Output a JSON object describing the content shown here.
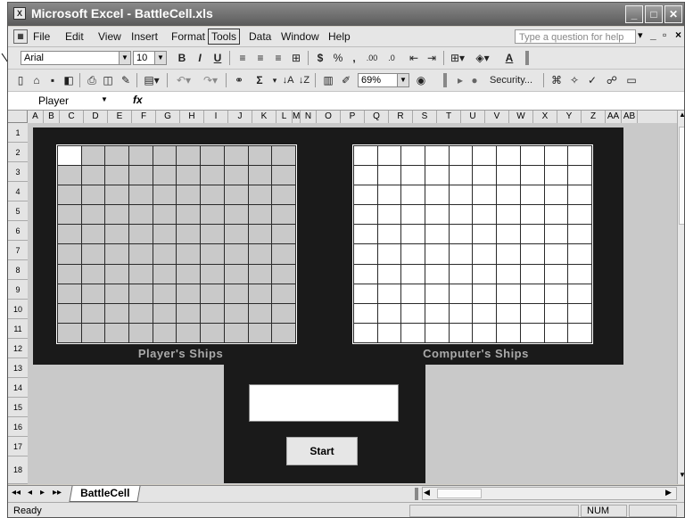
{
  "window": {
    "title": "Microsoft Excel - BattleCell.xls",
    "app_icon": "excel-icon"
  },
  "window_controls": {
    "minimize": "_",
    "maximize": "□",
    "close": "✕"
  },
  "menu": [
    "File",
    "Edit",
    "View",
    "Insert",
    "Format",
    "Tools",
    "Data",
    "Window",
    "Help"
  ],
  "help": {
    "placeholder": "Type a question for help",
    "arrow": "▾",
    "min": "_",
    "restore": "▫",
    "close": "×"
  },
  "formatting": {
    "font": "Arial",
    "size": "10",
    "bold": "B",
    "italic": "I",
    "underline": "U",
    "currency": "$",
    "percent": "%",
    "comma": ",",
    "inc_decimal": ".00",
    "dec_decimal": ".0",
    "font_color": "A"
  },
  "standard": {
    "autosum": "Σ",
    "zoom": "69%",
    "security": "Security..."
  },
  "formula_bar": {
    "name_box": "Player",
    "fx": "fx"
  },
  "columns": [
    "A",
    "B",
    "C",
    "D",
    "E",
    "F",
    "G",
    "H",
    "I",
    "J",
    "K",
    "L",
    "M",
    "N",
    "O",
    "P",
    "Q",
    "R",
    "S",
    "T",
    "U",
    "V",
    "W",
    "X",
    "Y",
    "Z",
    "AA",
    "AB"
  ],
  "rows": [
    "1",
    "2",
    "3",
    "4",
    "5",
    "6",
    "7",
    "8",
    "9",
    "10",
    "11",
    "12",
    "13",
    "14",
    "15",
    "16",
    "17",
    "18"
  ],
  "boards": {
    "player_label": "Player's Ships",
    "computer_label": "Computer's Ships"
  },
  "control": {
    "start_label": "Start",
    "message": ""
  },
  "sheet_tabs": {
    "nav": [
      "◂◂",
      "◂",
      "▸",
      "▸▸"
    ],
    "active": "BattleCell"
  },
  "status_bar": {
    "ready": "Ready",
    "num": "NUM"
  }
}
